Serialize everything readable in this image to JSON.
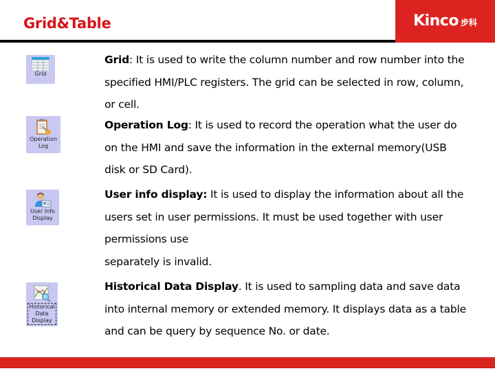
{
  "header": {
    "title": "Grid&Table",
    "logo": {
      "text": "Kinco",
      "text_cn": "步科",
      "icon": "kinco-logo"
    }
  },
  "colors": {
    "title_red": "#d7141a",
    "brand_red": "#dc2320",
    "icon_tile_bg": "#c8c8f2",
    "rule": "#000000"
  },
  "items": [
    {
      "icon": "grid-icon",
      "icon_label_lines": [
        "Grid"
      ],
      "term": "Grid",
      "separator": ": ",
      "description": "It is used to write the column number and row number into the specified HMI/PLC registers. The grid can be selected in row, column, or cell."
    },
    {
      "icon": "operation-log-icon",
      "icon_label_lines": [
        "Operation",
        "Log"
      ],
      "term": "Operation Log",
      "separator": ": ",
      "description": "It is used to record the operation what the user do on the HMI and save the information in the external memory(USB disk or SD Card)."
    },
    {
      "icon": "user-info-display-icon",
      "icon_label_lines": [
        "User Info",
        "Display"
      ],
      "term": "User info display:",
      "separator": " ",
      "description": "It is used to display the information about all the users set in user permissions. It must be used together with user permissions use",
      "description_line2": "separately is invalid."
    },
    {
      "icon": "historical-data-display-icon",
      "icon_label_lines": [
        "Historical",
        "Data",
        "Display"
      ],
      "term": "Historical Data Display",
      "separator": ". ",
      "description": "It is used to sampling data and save data into internal memory or extended memory. It displays data as a table and can be query by sequence No. or date."
    }
  ]
}
